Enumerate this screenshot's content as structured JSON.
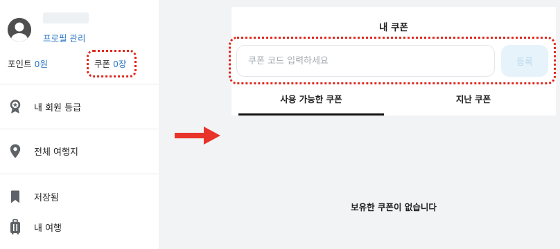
{
  "sidebar": {
    "profile_link": "프로필 관리",
    "points_label": "포인트",
    "points_value": "0원",
    "coupons_label": "쿠폰",
    "coupons_value": "0장",
    "menu": [
      {
        "label": "내 회원 등급",
        "icon": "membership-badge-icon"
      },
      {
        "label": "전체 여행지",
        "icon": "map-pin-icon"
      },
      {
        "label": "저장됨",
        "icon": "bookmark-icon"
      },
      {
        "label": "내 여행",
        "icon": "luggage-icon"
      }
    ]
  },
  "coupon_panel": {
    "title": "내 쿠폰",
    "code_input": {
      "placeholder": "쿠폰 코드 입력하세요",
      "value": ""
    },
    "register_label": "등록",
    "tabs": [
      {
        "label": "사용 가능한 쿠폰",
        "active": true
      },
      {
        "label": "지난 쿠폰",
        "active": false
      }
    ],
    "empty_message": "보유한 쿠폰이 없습니다"
  },
  "annotations": {
    "highlight_color": "#e0261a",
    "arrow_color": "#e8332a"
  },
  "colors": {
    "accent_blue": "#2f78c4",
    "icon_gray": "#5f6368",
    "register_button_bg": "#e6f3fb"
  }
}
